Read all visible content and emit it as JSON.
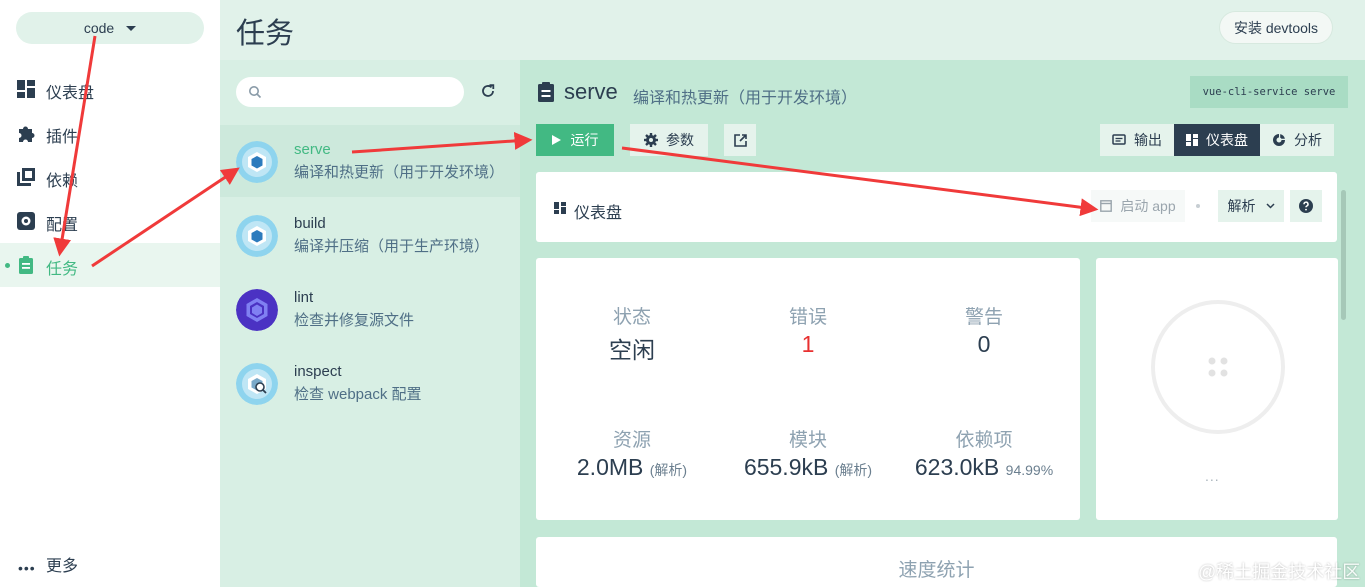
{
  "nav": {
    "project": "code",
    "items": [
      {
        "label": "仪表盘",
        "icon": "dashboard-icon"
      },
      {
        "label": "插件",
        "icon": "puzzle-icon"
      },
      {
        "label": "依赖",
        "icon": "library-icon"
      },
      {
        "label": "配置",
        "icon": "settings-icon"
      },
      {
        "label": "任务",
        "icon": "clipboard-icon",
        "active": true
      }
    ],
    "more": "更多"
  },
  "header": {
    "title": "任务",
    "devtools": "安装 devtools"
  },
  "search": {
    "placeholder": ""
  },
  "tasks": [
    {
      "name": "serve",
      "desc": "编译和热更新（用于开发环境）"
    },
    {
      "name": "build",
      "desc": "编译并压缩（用于生产环境）"
    },
    {
      "name": "lint",
      "desc": "检查并修复源文件"
    },
    {
      "name": "inspect",
      "desc": "检查 webpack 配置"
    }
  ],
  "detail": {
    "name": "serve",
    "desc": "编译和热更新（用于开发环境）",
    "command": "vue-cli-service serve",
    "run": "运行",
    "params": "参数",
    "tabs": [
      "输出",
      "仪表盘",
      "分析"
    ],
    "active_tab": "仪表盘"
  },
  "dashboard": {
    "title": "仪表盘",
    "launch_app": "启动 app",
    "analyze": "解析",
    "stats": [
      {
        "key": "状态",
        "value": "空闲"
      },
      {
        "key": "错误",
        "value": "1"
      },
      {
        "key": "警告",
        "value": "0"
      },
      {
        "key": "资源",
        "value": "2.0MB",
        "note": "(解析)"
      },
      {
        "key": "模块",
        "value": "655.9kB",
        "note": "(解析)"
      },
      {
        "key": "依赖项",
        "value": "623.0kB",
        "note": "94.99%"
      }
    ],
    "widget_more": "...",
    "speed_title": "速度统计"
  },
  "colors": {
    "accent": "#42b983",
    "dark": "#2c3e50",
    "error": "#e83030",
    "annotation": "#f03a3a"
  },
  "watermark": "@稀土掘金技术社区"
}
